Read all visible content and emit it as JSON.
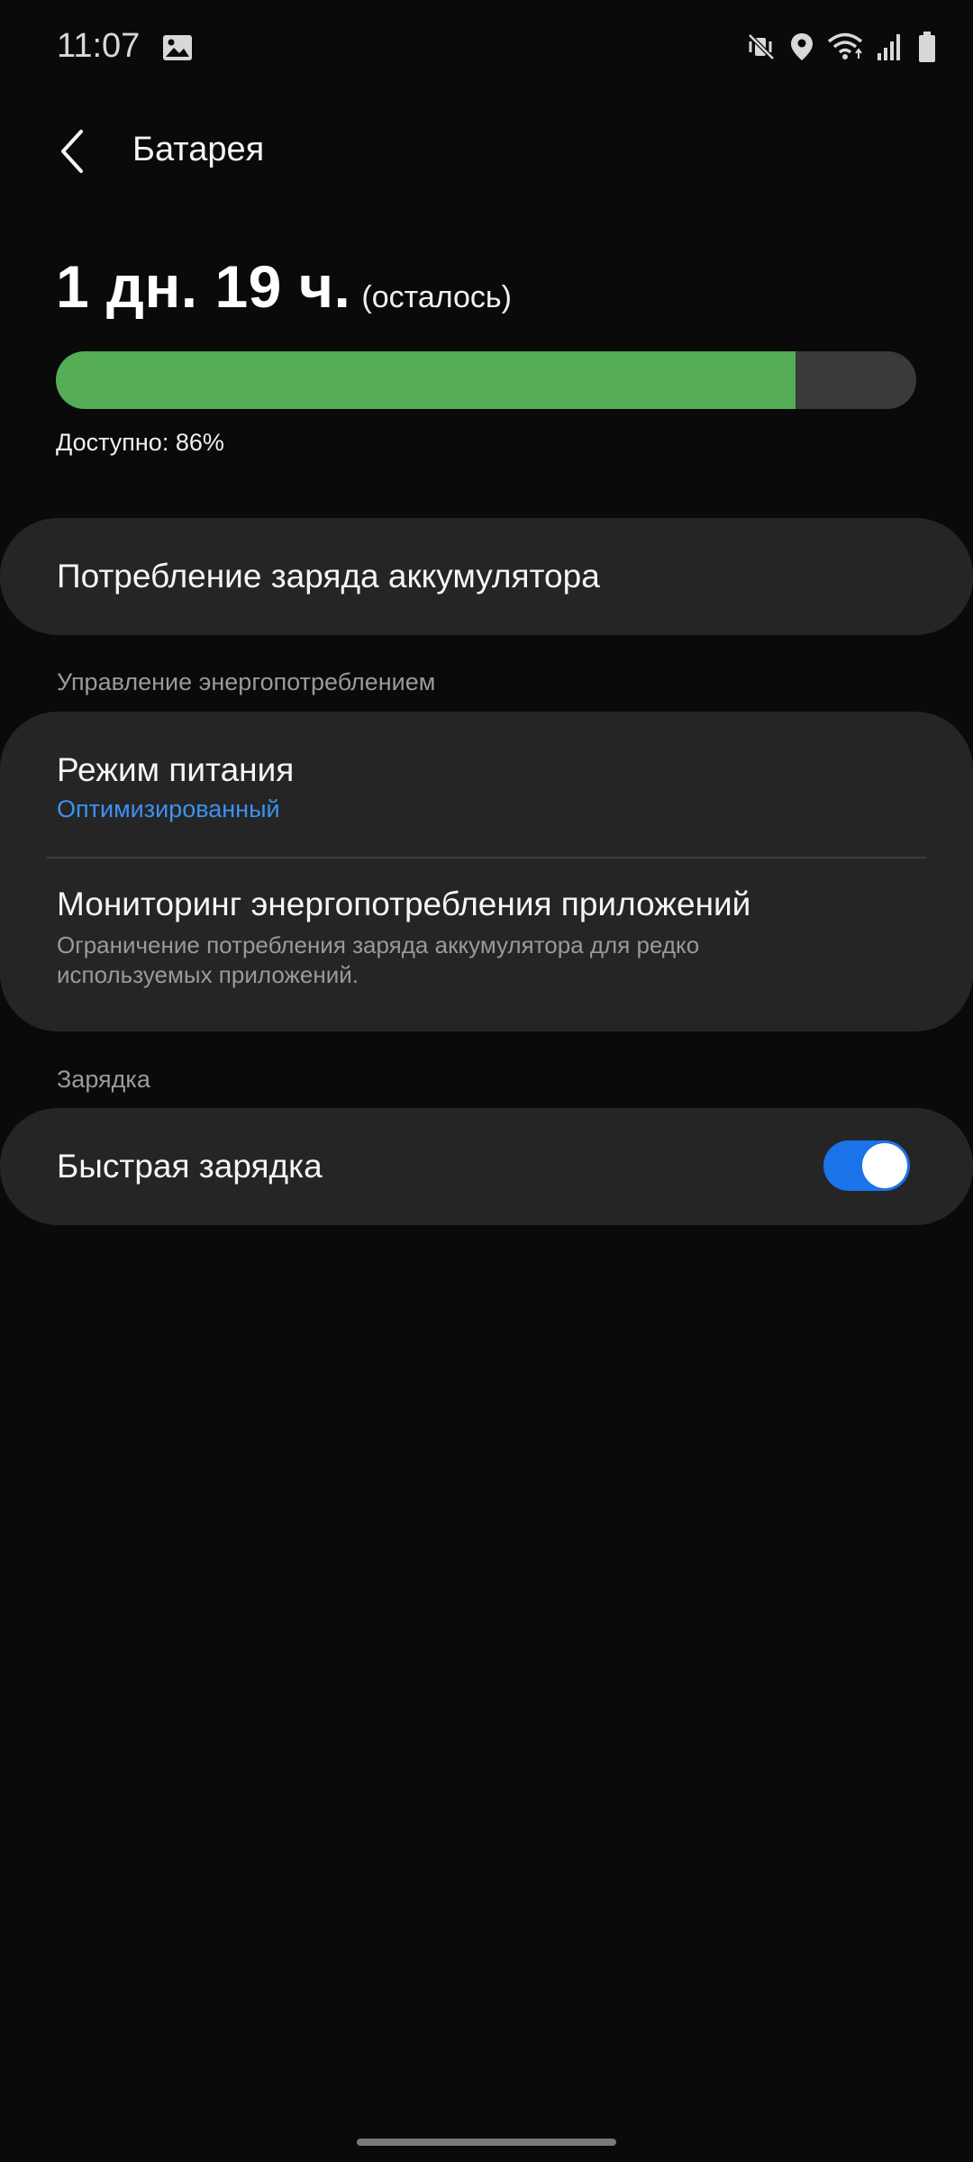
{
  "status_bar": {
    "time": "11:07",
    "icons": [
      "gallery-icon",
      "mute-vibrate-icon",
      "location-icon",
      "wifi-icon",
      "signal-icon",
      "battery-icon"
    ]
  },
  "header": {
    "back_icon": "back-arrow-icon",
    "title": "Батарея"
  },
  "battery": {
    "estimate": "1 дн. 19 ч.",
    "estimate_suffix": "(осталось)",
    "available_label": "Доступно: 86%",
    "level_percent": 86,
    "bar_color": "#55ad55",
    "track_color": "#3a3a3a"
  },
  "usage_item": {
    "label": "Потребление заряда аккумулятора"
  },
  "power_section": {
    "heading": "Управление энергопотреблением",
    "power_mode": {
      "label": "Режим питания",
      "value": "Оптимизированный",
      "value_color": "#3e91f0"
    },
    "monitoring": {
      "label": "Мониторинг энергопотребления приложений",
      "description": "Ограничение потребления заряда аккумулятора для редко используемых приложений."
    }
  },
  "charging_section": {
    "heading": "Зарядка",
    "fast_charging": {
      "label": "Быстрая зарядка",
      "enabled": true,
      "toggle_color": "#1a73e8"
    }
  }
}
